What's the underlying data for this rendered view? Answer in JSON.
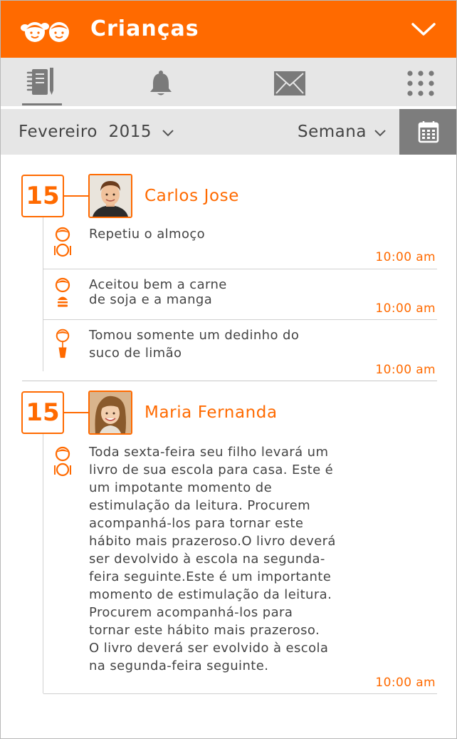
{
  "header": {
    "title": "Crianças",
    "logo_icon": "kids-faces-logo-icon",
    "menu_icon": "chevron-down-icon",
    "color": "#ff6a00"
  },
  "toolbar": {
    "items": [
      {
        "name": "agenda",
        "icon": "notebook-pen-icon",
        "active": true
      },
      {
        "name": "notifications",
        "icon": "bell-icon",
        "active": false
      },
      {
        "name": "messages",
        "icon": "envelope-icon",
        "active": false
      },
      {
        "name": "apps",
        "icon": "grid-dots-icon",
        "active": false
      }
    ]
  },
  "datebar": {
    "month": "Fevereiro",
    "year": "2015",
    "period": "Semana",
    "calendar_icon": "calendar-icon"
  },
  "entries": [
    {
      "day": "15",
      "child": "Carlos Jose",
      "items": [
        {
          "icon": "meal-plate-icon",
          "text": [
            "Repetiu o almoço"
          ],
          "time": "10:00 am"
        },
        {
          "icon": "burger-icon",
          "text": [
            "Aceitou bem a carne",
            "de soja e a manga"
          ],
          "time": "10:00 am"
        },
        {
          "icon": "drink-cup-icon",
          "text": [
            "Tomou somente um dedinho do",
            "suco de limão"
          ],
          "time": "10:00 am"
        }
      ]
    },
    {
      "day": "15",
      "child": "Maria Fernanda",
      "items": [
        {
          "icon": "meal-plate-icon",
          "text": [
            "Toda sexta-feira seu filho levará um",
            "livro de sua escola para casa. Este é",
            "um impotante momento de",
            "estimulação da leitura. Procurem",
            "acompanhá-los para tornar este",
            "hábito mais prazeroso.O livro deverá",
            "ser devolvido à escola na segunda-",
            "feira seguinte.Este é um importante",
            "momento de estimulação da leitura.",
            "Procurem acompanhá-los para",
            "tornar este hábito mais prazeroso.",
            "O livro deverá ser evolvido à escola",
            "na segunda-feira seguinte."
          ],
          "time": "10:00 am"
        }
      ]
    }
  ]
}
